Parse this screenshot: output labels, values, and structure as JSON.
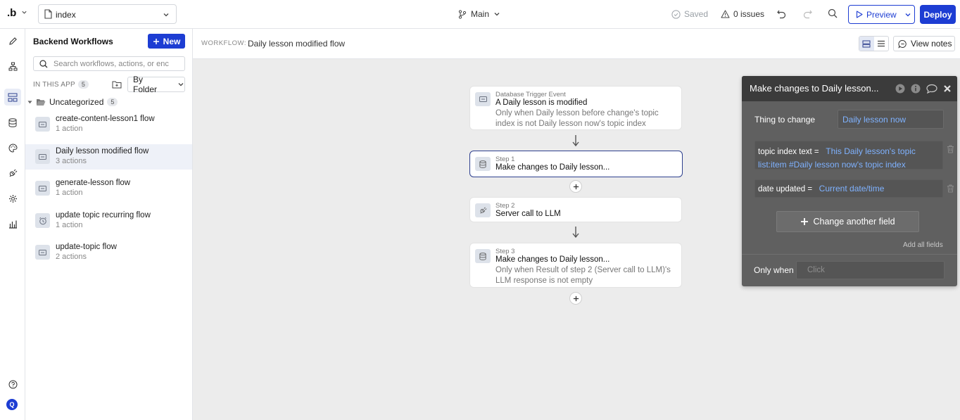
{
  "topbar": {
    "logo": ".b",
    "page_name": "index",
    "branch": "Main",
    "saved_label": "Saved",
    "issues_label": "0 issues",
    "preview_label": "Preview",
    "deploy_label": "Deploy"
  },
  "rail": {
    "avatar_initial": "Q"
  },
  "sidebar": {
    "title": "Backend Workflows",
    "new_label": "New",
    "search_placeholder": "Search workflows, actions, or enc",
    "in_this_app_label": "IN THIS APP",
    "in_this_app_count": "5",
    "group_by": "By Folder",
    "folder": {
      "name": "Uncategorized",
      "count": "5"
    },
    "workflows": [
      {
        "name": "create-content-lesson1 flow",
        "actions": "1 action"
      },
      {
        "name": "Daily lesson modified flow",
        "actions": "3 actions"
      },
      {
        "name": "generate-lesson flow",
        "actions": "1 action"
      },
      {
        "name": "update topic recurring flow",
        "actions": "1 action"
      },
      {
        "name": "update-topic flow",
        "actions": "2 actions"
      }
    ]
  },
  "workflow_header": {
    "label": "WORKFLOW:",
    "name": "Daily lesson modified flow",
    "view_notes_label": "View notes"
  },
  "canvas": {
    "trigger": {
      "kicker": "Database Trigger Event",
      "title": "A Daily lesson is modified",
      "condition": "Only when Daily lesson before change's topic index is not Daily lesson now's topic index"
    },
    "steps": [
      {
        "kicker": "Step 1",
        "title": "Make changes to Daily lesson...",
        "condition": ""
      },
      {
        "kicker": "Step 2",
        "title": "Server call to LLM",
        "condition": ""
      },
      {
        "kicker": "Step 3",
        "title": "Make changes to Daily lesson...",
        "condition": "Only when Result of step 2 (Server call to LLM)'s LLM response is not empty"
      }
    ]
  },
  "editor": {
    "title": "Make changes to Daily lesson...",
    "thing_label": "Thing to change",
    "thing_value": "Daily lesson now",
    "field1_name": "topic index text",
    "field1_eq": "=",
    "field1_value": "This Daily lesson's topic list:item #Daily lesson now's topic index",
    "field2_name": "date updated",
    "field2_eq": "=",
    "field2_value": "Current date/time",
    "change_another_label": "Change another field",
    "add_all_label": "Add all fields",
    "only_when_label": "Only when",
    "only_when_placeholder": "Click"
  },
  "colors": {
    "accent": "#1d3dd3",
    "selected_border": "#2d3f8e",
    "link_blue": "#7fb2ff",
    "editor_bg": "#606060",
    "editor_head": "#3b3b3b",
    "canvas_bg": "#ececec"
  }
}
